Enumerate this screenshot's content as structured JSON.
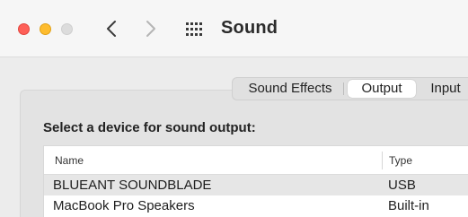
{
  "window": {
    "title": "Sound",
    "icons": {
      "close": "close-icon",
      "minimize": "minimize-icon",
      "zoom": "zoom-icon",
      "back": "chevron-left-icon",
      "forward": "chevron-right-icon",
      "show_all": "grid-icon"
    }
  },
  "tabs": [
    {
      "label": "Sound Effects",
      "selected": false
    },
    {
      "label": "Output",
      "selected": true
    },
    {
      "label": "Input",
      "selected": false
    }
  ],
  "prompt": "Select a device for sound output:",
  "table": {
    "columns": [
      "Name",
      "Type"
    ],
    "rows": [
      {
        "name": "BLUEANT SOUNDBLADE",
        "type": "USB",
        "selected": true
      },
      {
        "name": "MacBook Pro Speakers",
        "type": "Built-in",
        "selected": false
      }
    ]
  },
  "colors": {
    "close": "#fe5f57",
    "minimize": "#febc2e",
    "zoom_inactive": "#dcdcdc",
    "selected_row": "#e6e6e6"
  }
}
